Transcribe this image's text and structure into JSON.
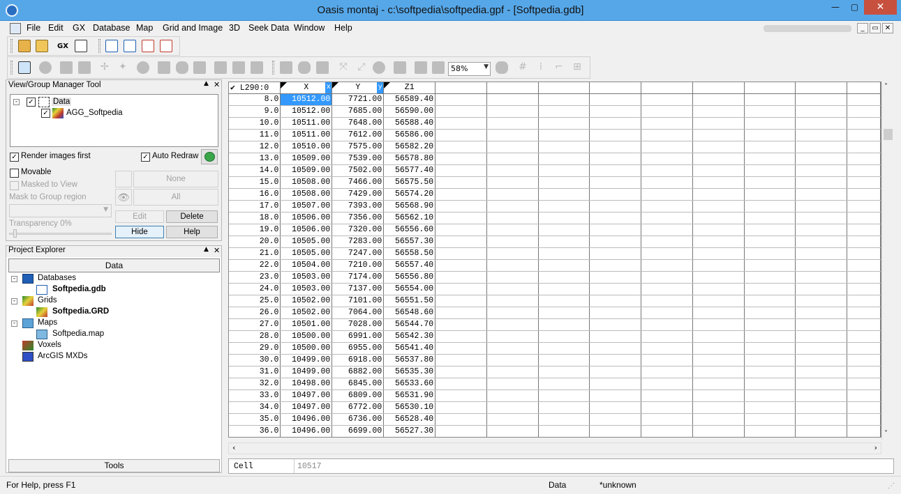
{
  "window": {
    "title": "Oasis montaj - c:\\softpedia\\softpedia.gpf - [Softpedia.gdb]",
    "minimize": "—",
    "maximize": "▢",
    "close": "✕"
  },
  "menu": [
    "File",
    "Edit",
    "GX",
    "Database",
    "Map",
    "Grid and Image",
    "3D",
    "Seek Data",
    "Window",
    "Help"
  ],
  "mdi": {
    "min": "_",
    "restore": "▭",
    "close": "✕"
  },
  "toolbar": {
    "gx_label": "GX",
    "zoom": "58%"
  },
  "view_group": {
    "title": "View/Group Manager Tool",
    "tree": [
      {
        "label": "Data",
        "checked": true
      },
      {
        "label": "AGG_Softpedia",
        "checked": true
      }
    ],
    "render_images_first": "Render images first",
    "auto_redraw": "Auto Redraw",
    "movable": "Movable",
    "masked_to_view": "Masked to View",
    "mask_to_group_region": "Mask to Group region",
    "none_label": "None",
    "all_label": "All",
    "transparency": "Transparency 0%",
    "edit": "Edit",
    "delete": "Delete",
    "hide": "Hide",
    "help": "Help"
  },
  "project_explorer": {
    "title": "Project Explorer",
    "tab": "Data",
    "databases": "Databases",
    "database_file": "Softpedia.gdb",
    "grids": "Grids",
    "grid_file": "Softpedia.GRD",
    "maps": "Maps",
    "map_file": "Softpedia.map",
    "voxels": "Voxels",
    "arcgis": "ArcGIS MXDs",
    "tools_tab": "Tools"
  },
  "grid": {
    "line_label": "L290:0",
    "columns": [
      "X",
      "Y",
      "Z1"
    ],
    "x_tag": "x",
    "y_tag": "y",
    "rows": [
      [
        "8.0",
        "10512.00",
        "7721.00",
        "56589.40"
      ],
      [
        "9.0",
        "10512.00",
        "7685.00",
        "56590.00"
      ],
      [
        "10.0",
        "10511.00",
        "7648.00",
        "56588.40"
      ],
      [
        "11.0",
        "10511.00",
        "7612.00",
        "56586.00"
      ],
      [
        "12.0",
        "10510.00",
        "7575.00",
        "56582.20"
      ],
      [
        "13.0",
        "10509.00",
        "7539.00",
        "56578.80"
      ],
      [
        "14.0",
        "10509.00",
        "7502.00",
        "56577.40"
      ],
      [
        "15.0",
        "10508.00",
        "7466.00",
        "56575.50"
      ],
      [
        "16.0",
        "10508.00",
        "7429.00",
        "56574.20"
      ],
      [
        "17.0",
        "10507.00",
        "7393.00",
        "56568.90"
      ],
      [
        "18.0",
        "10506.00",
        "7356.00",
        "56562.10"
      ],
      [
        "19.0",
        "10506.00",
        "7320.00",
        "56556.60"
      ],
      [
        "20.0",
        "10505.00",
        "7283.00",
        "56557.30"
      ],
      [
        "21.0",
        "10505.00",
        "7247.00",
        "56558.50"
      ],
      [
        "22.0",
        "10504.00",
        "7210.00",
        "56557.40"
      ],
      [
        "23.0",
        "10503.00",
        "7174.00",
        "56556.80"
      ],
      [
        "24.0",
        "10503.00",
        "7137.00",
        "56554.00"
      ],
      [
        "25.0",
        "10502.00",
        "7101.00",
        "56551.50"
      ],
      [
        "26.0",
        "10502.00",
        "7064.00",
        "56548.60"
      ],
      [
        "27.0",
        "10501.00",
        "7028.00",
        "56544.70"
      ],
      [
        "28.0",
        "10500.00",
        "6991.00",
        "56542.30"
      ],
      [
        "29.0",
        "10500.00",
        "6955.00",
        "56541.40"
      ],
      [
        "30.0",
        "10499.00",
        "6918.00",
        "56537.80"
      ],
      [
        "31.0",
        "10499.00",
        "6882.00",
        "56535.30"
      ],
      [
        "32.0",
        "10498.00",
        "6845.00",
        "56533.60"
      ],
      [
        "33.0",
        "10497.00",
        "6809.00",
        "56531.90"
      ],
      [
        "34.0",
        "10497.00",
        "6772.00",
        "56530.10"
      ],
      [
        "35.0",
        "10496.00",
        "6736.00",
        "56528.40"
      ],
      [
        "36.0",
        "10496.00",
        "6699.00",
        "56527.30"
      ]
    ]
  },
  "cell_bar": {
    "label": "Cell",
    "value": "10517"
  },
  "status": {
    "help": "For Help, press F1",
    "mode": "Data",
    "state": "*unknown"
  },
  "colors": {
    "title_bar": "#56a7e8",
    "selection": "#3399ff",
    "close_button": "#c7503f"
  }
}
